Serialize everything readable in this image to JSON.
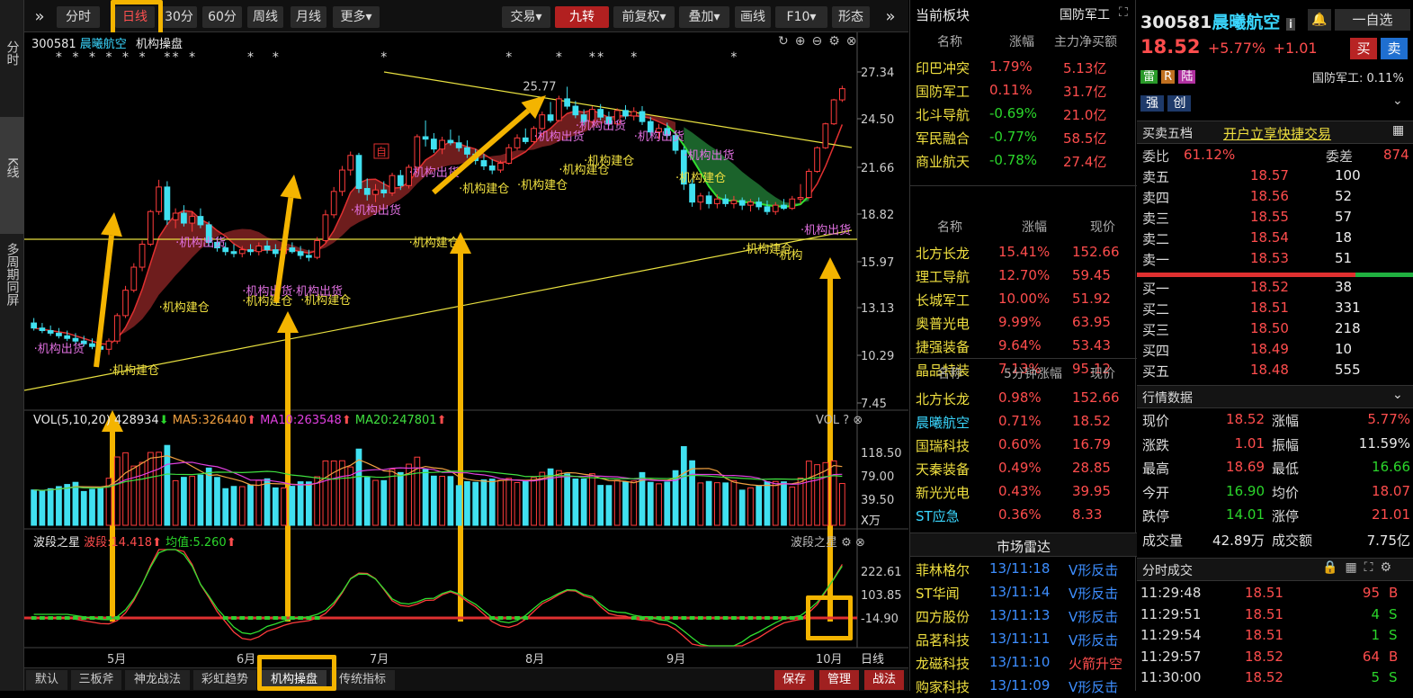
{
  "side": {
    "items": [
      "分时",
      "K线",
      "多周期同屏"
    ]
  },
  "toolbar": {
    "expand": "»",
    "periods": [
      "分时",
      "日线",
      "30分",
      "60分",
      "周线",
      "月线",
      "更多▾"
    ],
    "selected": "日线",
    "right": [
      "交易▾",
      "九转",
      "前复权▾",
      "叠加▾",
      "画线",
      "F10▾",
      "形态"
    ]
  },
  "chart": {
    "code": "300581",
    "name": "晨曦航空",
    "indicator": "机构操盘",
    "price_labels": [
      "27.34",
      "24.50",
      "21.66",
      "18.82",
      "15.97",
      "13.13",
      "10.29",
      "7.45"
    ],
    "peak_label": "25.77",
    "vol": {
      "title": "VOL(5,10,20)",
      "value": "428934",
      "ma5": "MA5:326440",
      "ma10": "MA10:263548",
      "ma20": "MA20:247801",
      "tag": "VOL",
      "labels": [
        "118.50",
        "79.00",
        "39.50"
      ],
      "unit": "X万"
    },
    "osc": {
      "title": "波段之星",
      "bd": "波段:14.418",
      "jz": "均值:5.260",
      "tag": "波段之星",
      "labels": [
        "222.61",
        "103.85",
        "-14.90"
      ]
    },
    "months": [
      "5月",
      "6月",
      "7月",
      "8月",
      "9月",
      "10月"
    ],
    "period_tag": "日线",
    "ann_buy": "机构建仓",
    "ann_sell": "机构出货",
    "ann_short": "机构",
    "self_tag": "自",
    "stars": "*",
    "candles": [
      {
        "o": 10.2,
        "h": 10.4,
        "l": 9.9,
        "c": 10.0
      },
      {
        "o": 10.0,
        "h": 10.2,
        "l": 9.8,
        "c": 9.9
      },
      {
        "o": 9.9,
        "h": 10.1,
        "l": 9.7,
        "c": 9.8
      },
      {
        "o": 9.8,
        "h": 10.0,
        "l": 9.6,
        "c": 9.7
      },
      {
        "o": 9.7,
        "h": 9.9,
        "l": 9.5,
        "c": 9.6
      },
      {
        "o": 9.6,
        "h": 9.8,
        "l": 9.4,
        "c": 9.5
      },
      {
        "o": 9.5,
        "h": 9.7,
        "l": 9.3,
        "c": 9.4
      },
      {
        "o": 9.4,
        "h": 9.6,
        "l": 9.2,
        "c": 9.3
      },
      {
        "o": 9.3,
        "h": 9.5,
        "l": 9.1,
        "c": 9.2
      },
      {
        "o": 9.2,
        "h": 9.6,
        "l": 9.0,
        "c": 9.5
      },
      {
        "o": 9.5,
        "h": 10.6,
        "l": 9.4,
        "c": 10.5
      },
      {
        "o": 10.5,
        "h": 11.8,
        "l": 10.4,
        "c": 11.6
      },
      {
        "o": 11.6,
        "h": 12.9,
        "l": 11.5,
        "c": 12.7
      },
      {
        "o": 12.7,
        "h": 14.1,
        "l": 12.5,
        "c": 13.9
      },
      {
        "o": 13.9,
        "h": 15.9,
        "l": 13.8,
        "c": 15.8
      },
      {
        "o": 15.8,
        "h": 17.9,
        "l": 15.6,
        "c": 17.4
      },
      {
        "o": 17.4,
        "h": 17.8,
        "l": 15.0,
        "c": 15.3
      },
      {
        "o": 15.3,
        "h": 16.0,
        "l": 14.8,
        "c": 15.7
      },
      {
        "o": 15.7,
        "h": 16.2,
        "l": 14.9,
        "c": 15.1
      },
      {
        "o": 15.1,
        "h": 15.8,
        "l": 14.6,
        "c": 15.5
      },
      {
        "o": 15.5,
        "h": 16.0,
        "l": 14.8,
        "c": 15.0
      },
      {
        "o": 15.0,
        "h": 15.2,
        "l": 13.8,
        "c": 14.0
      },
      {
        "o": 14.0,
        "h": 14.3,
        "l": 13.5,
        "c": 13.7
      },
      {
        "o": 13.7,
        "h": 14.0,
        "l": 13.3,
        "c": 13.5
      },
      {
        "o": 13.5,
        "h": 13.9,
        "l": 13.2,
        "c": 13.4
      },
      {
        "o": 13.4,
        "h": 13.8,
        "l": 13.2,
        "c": 13.6
      },
      {
        "o": 13.6,
        "h": 13.9,
        "l": 13.3,
        "c": 13.5
      },
      {
        "o": 13.5,
        "h": 14.0,
        "l": 13.3,
        "c": 13.8
      },
      {
        "o": 13.8,
        "h": 14.1,
        "l": 13.4,
        "c": 13.6
      },
      {
        "o": 13.6,
        "h": 13.9,
        "l": 13.2,
        "c": 13.4
      },
      {
        "o": 13.4,
        "h": 13.8,
        "l": 13.2,
        "c": 13.7
      },
      {
        "o": 13.7,
        "h": 14.0,
        "l": 13.4,
        "c": 13.5
      },
      {
        "o": 13.5,
        "h": 13.8,
        "l": 13.1,
        "c": 13.3
      },
      {
        "o": 13.3,
        "h": 13.6,
        "l": 13.0,
        "c": 13.2
      },
      {
        "o": 13.2,
        "h": 14.3,
        "l": 13.1,
        "c": 14.1
      },
      {
        "o": 14.1,
        "h": 15.9,
        "l": 14.0,
        "c": 15.6
      },
      {
        "o": 15.6,
        "h": 17.4,
        "l": 15.4,
        "c": 17.1
      },
      {
        "o": 17.1,
        "h": 18.9,
        "l": 16.8,
        "c": 18.6
      },
      {
        "o": 18.6,
        "h": 20.0,
        "l": 18.2,
        "c": 19.7
      },
      {
        "o": 19.7,
        "h": 19.9,
        "l": 17.0,
        "c": 17.3
      },
      {
        "o": 17.3,
        "h": 18.0,
        "l": 16.5,
        "c": 16.9
      },
      {
        "o": 16.9,
        "h": 17.6,
        "l": 16.4,
        "c": 17.2
      },
      {
        "o": 17.2,
        "h": 17.8,
        "l": 16.7,
        "c": 17.0
      },
      {
        "o": 17.0,
        "h": 18.4,
        "l": 16.8,
        "c": 18.2
      },
      {
        "o": 18.2,
        "h": 18.6,
        "l": 17.2,
        "c": 17.5
      },
      {
        "o": 17.5,
        "h": 19.0,
        "l": 17.3,
        "c": 18.8
      },
      {
        "o": 18.8,
        "h": 21.4,
        "l": 18.6,
        "c": 21.2
      },
      {
        "o": 21.2,
        "h": 22.6,
        "l": 20.4,
        "c": 21.0
      },
      {
        "o": 21.0,
        "h": 21.5,
        "l": 19.9,
        "c": 20.2
      },
      {
        "o": 20.2,
        "h": 21.2,
        "l": 19.8,
        "c": 20.9
      },
      {
        "o": 20.9,
        "h": 21.8,
        "l": 20.5,
        "c": 20.7
      },
      {
        "o": 20.7,
        "h": 21.3,
        "l": 20.0,
        "c": 20.3
      },
      {
        "o": 20.3,
        "h": 20.9,
        "l": 19.5,
        "c": 19.8
      },
      {
        "o": 19.8,
        "h": 20.2,
        "l": 19.0,
        "c": 19.3
      },
      {
        "o": 19.3,
        "h": 19.8,
        "l": 18.6,
        "c": 18.9
      },
      {
        "o": 18.9,
        "h": 19.4,
        "l": 18.3,
        "c": 18.6
      },
      {
        "o": 18.6,
        "h": 19.3,
        "l": 18.4,
        "c": 19.1
      },
      {
        "o": 19.1,
        "h": 20.6,
        "l": 19.0,
        "c": 20.3
      },
      {
        "o": 20.3,
        "h": 21.4,
        "l": 20.1,
        "c": 21.1
      },
      {
        "o": 21.1,
        "h": 21.9,
        "l": 20.6,
        "c": 20.8
      },
      {
        "o": 20.8,
        "h": 22.1,
        "l": 20.7,
        "c": 21.9
      },
      {
        "o": 21.9,
        "h": 23.4,
        "l": 21.7,
        "c": 23.1
      },
      {
        "o": 23.1,
        "h": 24.3,
        "l": 22.4,
        "c": 22.6
      },
      {
        "o": 22.6,
        "h": 24.9,
        "l": 22.5,
        "c": 24.6
      },
      {
        "o": 24.6,
        "h": 25.8,
        "l": 23.6,
        "c": 23.9
      },
      {
        "o": 23.9,
        "h": 24.4,
        "l": 22.8,
        "c": 23.1
      },
      {
        "o": 23.1,
        "h": 23.6,
        "l": 22.2,
        "c": 22.5
      },
      {
        "o": 22.5,
        "h": 23.9,
        "l": 22.3,
        "c": 23.6
      },
      {
        "o": 23.6,
        "h": 24.1,
        "l": 22.6,
        "c": 22.9
      },
      {
        "o": 22.9,
        "h": 23.4,
        "l": 22.1,
        "c": 22.3
      },
      {
        "o": 22.3,
        "h": 23.7,
        "l": 22.2,
        "c": 23.5
      },
      {
        "o": 23.5,
        "h": 24.0,
        "l": 22.7,
        "c": 23.0
      },
      {
        "o": 23.0,
        "h": 23.8,
        "l": 22.6,
        "c": 23.4
      },
      {
        "o": 23.4,
        "h": 23.9,
        "l": 22.2,
        "c": 22.5
      },
      {
        "o": 22.5,
        "h": 22.9,
        "l": 21.3,
        "c": 21.6
      },
      {
        "o": 21.6,
        "h": 22.3,
        "l": 21.0,
        "c": 21.9
      },
      {
        "o": 21.9,
        "h": 22.4,
        "l": 21.1,
        "c": 21.3
      },
      {
        "o": 21.3,
        "h": 21.7,
        "l": 19.8,
        "c": 20.1
      },
      {
        "o": 20.1,
        "h": 20.4,
        "l": 17.2,
        "c": 17.6
      },
      {
        "o": 17.6,
        "h": 18.0,
        "l": 16.1,
        "c": 16.4
      },
      {
        "o": 16.4,
        "h": 17.0,
        "l": 15.9,
        "c": 16.8
      },
      {
        "o": 16.8,
        "h": 17.1,
        "l": 16.0,
        "c": 16.3
      },
      {
        "o": 16.3,
        "h": 16.9,
        "l": 16.0,
        "c": 16.6
      },
      {
        "o": 16.6,
        "h": 16.9,
        "l": 16.1,
        "c": 16.3
      },
      {
        "o": 16.3,
        "h": 16.8,
        "l": 16.0,
        "c": 16.5
      },
      {
        "o": 16.5,
        "h": 16.7,
        "l": 15.9,
        "c": 16.2
      },
      {
        "o": 16.2,
        "h": 16.6,
        "l": 15.8,
        "c": 16.4
      },
      {
        "o": 16.4,
        "h": 16.7,
        "l": 15.9,
        "c": 16.1
      },
      {
        "o": 16.1,
        "h": 16.5,
        "l": 15.6,
        "c": 15.8
      },
      {
        "o": 15.8,
        "h": 16.4,
        "l": 15.6,
        "c": 16.2
      },
      {
        "o": 16.2,
        "h": 16.6,
        "l": 15.9,
        "c": 16.0
      },
      {
        "o": 16.0,
        "h": 16.8,
        "l": 15.9,
        "c": 16.6
      },
      {
        "o": 16.6,
        "h": 17.6,
        "l": 16.3,
        "c": 16.7
      },
      {
        "o": 16.7,
        "h": 18.7,
        "l": 16.6,
        "c": 18.5
      },
      {
        "o": 18.5,
        "h": 20.4,
        "l": 18.4,
        "c": 20.3
      },
      {
        "o": 20.3,
        "h": 22.4,
        "l": 20.2,
        "c": 22.3
      },
      {
        "o": 22.3,
        "h": 24.6,
        "l": 22.2,
        "c": 24.5
      },
      {
        "o": 24.5,
        "h": 25.9,
        "l": 24.3,
        "c": 25.6
      }
    ]
  },
  "bottom": {
    "tabs": [
      "默认",
      "三板斧",
      "神龙战法",
      "彩虹趋势",
      "机构操盘",
      "传统指标"
    ],
    "selected": "机构操盘",
    "actions": [
      "保存",
      "管理",
      "战法"
    ]
  },
  "sector": {
    "title": "当前板块",
    "current": "国防军工",
    "h1": [
      "名称",
      "涨幅",
      "主力净买额"
    ],
    "rows1": [
      [
        "印巴冲突",
        "1.79%",
        "5.13亿"
      ],
      [
        "国防军工",
        "0.11%",
        "31.7亿"
      ],
      [
        "北斗导航",
        "-0.69%",
        "21.0亿"
      ],
      [
        "军民融合",
        "-0.77%",
        "58.5亿"
      ],
      [
        "商业航天",
        "-0.78%",
        "27.4亿"
      ]
    ],
    "h2": [
      "名称",
      "涨幅",
      "现价"
    ],
    "rows2": [
      [
        "北方长龙",
        "15.41%",
        "152.66"
      ],
      [
        "理工导航",
        "12.70%",
        "59.45"
      ],
      [
        "长城军工",
        "10.00%",
        "51.92"
      ],
      [
        "奥普光电",
        "9.99%",
        "63.95"
      ],
      [
        "捷强装备",
        "9.64%",
        "53.43"
      ],
      [
        "晶品特装",
        "7.13%",
        "95.12"
      ]
    ],
    "h3": [
      "名称",
      "5分钟涨幅",
      "现价"
    ],
    "rows3": [
      [
        "北方长龙",
        "0.98%",
        "152.66"
      ],
      [
        "晨曦航空",
        "0.71%",
        "18.52"
      ],
      [
        "国瑞科技",
        "0.60%",
        "16.79"
      ],
      [
        "天秦装备",
        "0.49%",
        "28.85"
      ],
      [
        "新光光电",
        "0.43%",
        "39.95"
      ],
      [
        "ST应急",
        "0.36%",
        "8.33"
      ]
    ],
    "radar_title": "市场雷达",
    "radar": [
      [
        "菲林格尔",
        "13/11:18",
        "V形反击"
      ],
      [
        "ST华闻",
        "13/11:14",
        "V形反击"
      ],
      [
        "四方股份",
        "13/11:13",
        "V形反击"
      ],
      [
        "品茗科技",
        "13/11:11",
        "V形反击"
      ],
      [
        "龙磁科技",
        "13/11:10",
        "火箭升空"
      ],
      [
        "购家科技",
        "13/11:09",
        "V形反击"
      ]
    ]
  },
  "quote": {
    "code": "300581",
    "name": "晨曦航空",
    "info": "i",
    "self": "一自选",
    "price": "18.52",
    "chg_pct": "+5.77%",
    "chg": "+1.01",
    "buy": "买",
    "sell": "卖",
    "tags": [
      "雷",
      "R",
      "陆"
    ],
    "sector_chg": "国防军工: 0.11%",
    "btns": [
      "强",
      "创"
    ],
    "five_title": "买卖五档",
    "open_tip": "开户立享快捷交易",
    "wb_label": "委比",
    "wb": "61.12%",
    "wc_label": "委差",
    "wc": "874",
    "asks": [
      [
        "卖五",
        "18.57",
        "100"
      ],
      [
        "卖四",
        "18.56",
        "52"
      ],
      [
        "卖三",
        "18.55",
        "57"
      ],
      [
        "卖二",
        "18.54",
        "18"
      ],
      [
        "卖一",
        "18.53",
        "51"
      ]
    ],
    "bids": [
      [
        "买一",
        "18.52",
        "38"
      ],
      [
        "买二",
        "18.51",
        "331"
      ],
      [
        "买三",
        "18.50",
        "218"
      ],
      [
        "买四",
        "18.49",
        "10"
      ],
      [
        "买五",
        "18.48",
        "555"
      ]
    ],
    "stats_title": "行情数据",
    "stats": [
      [
        "现价",
        "18.52",
        "涨幅",
        "5.77%"
      ],
      [
        "涨跌",
        "1.01",
        "振幅",
        "11.59%"
      ],
      [
        "最高",
        "18.69",
        "最低",
        "16.66"
      ],
      [
        "今开",
        "16.90",
        "均价",
        "18.07"
      ],
      [
        "跌停",
        "14.01",
        "涨停",
        "21.01"
      ],
      [
        "成交量",
        "42.89万",
        "成交额",
        "7.75亿"
      ]
    ],
    "ticks_title": "分时成交",
    "ticks": [
      [
        "11:29:48",
        "18.51",
        "95",
        "B"
      ],
      [
        "11:29:51",
        "18.51",
        "4",
        "S"
      ],
      [
        "11:29:54",
        "18.51",
        "1",
        "S"
      ],
      [
        "11:29:57",
        "18.52",
        "64",
        "B"
      ],
      [
        "11:30:00",
        "18.52",
        "5",
        "S"
      ]
    ]
  }
}
